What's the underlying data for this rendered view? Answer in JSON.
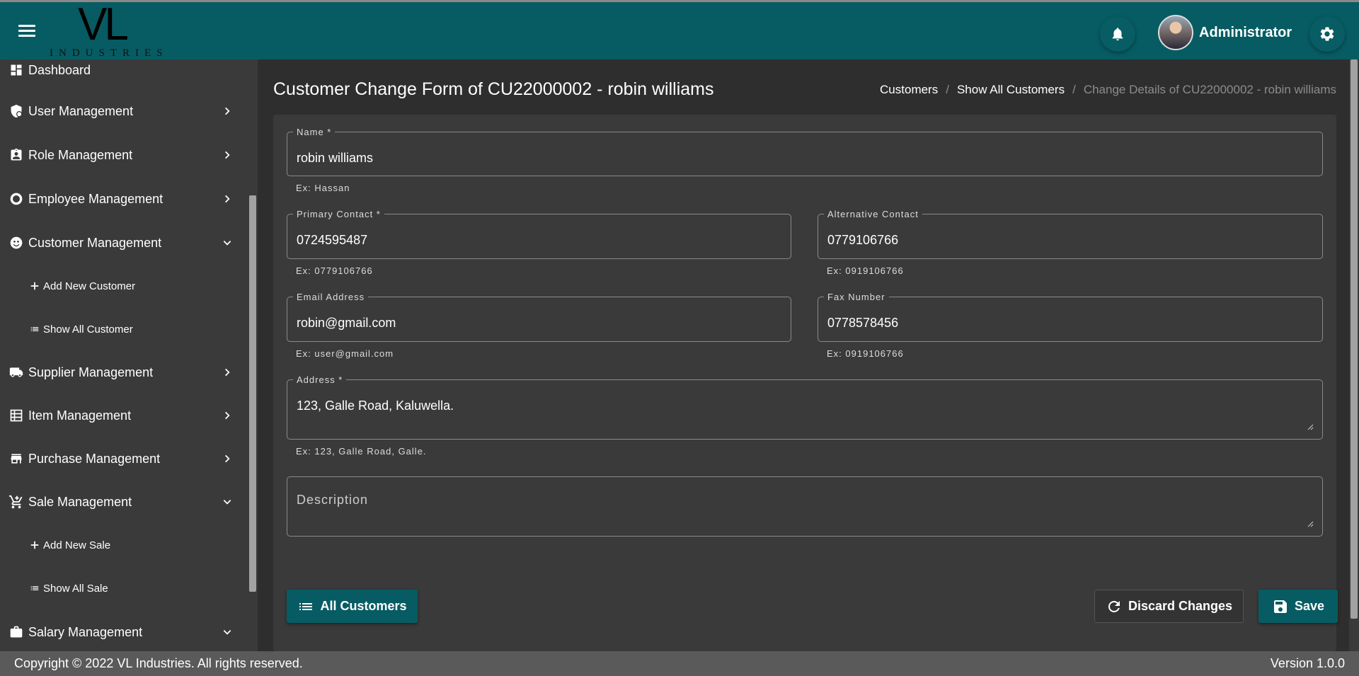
{
  "header": {
    "logo_main": "VL",
    "logo_sub": "INDUSTRIES",
    "user_name": "Administrator",
    "menu_icon": "hamburger-icon",
    "bell_icon": "bell-icon",
    "settings_icon": "gear-icon"
  },
  "sidebar": {
    "items": [
      {
        "label": "Dashboard",
        "icon": "dashboard-icon"
      },
      {
        "label": "User Management",
        "icon": "user-shield-icon"
      },
      {
        "label": "Role Management",
        "icon": "id-badge-icon"
      },
      {
        "label": "Employee Management",
        "icon": "circle-icon"
      },
      {
        "label": "Customer Management",
        "icon": "face-icon"
      },
      {
        "label": "Add New Customer",
        "icon": "plus-icon"
      },
      {
        "label": "Show All Customer",
        "icon": "list-icon"
      },
      {
        "label": "Supplier Management",
        "icon": "truck-icon"
      },
      {
        "label": "Item Management",
        "icon": "table-icon"
      },
      {
        "label": "Purchase Management",
        "icon": "store-icon"
      },
      {
        "label": "Sale Management",
        "icon": "cart-icon"
      },
      {
        "label": "Add New Sale",
        "icon": "plus-icon"
      },
      {
        "label": "Show All Sale",
        "icon": "list-icon"
      },
      {
        "label": "Salary Management",
        "icon": "briefcase-icon"
      }
    ]
  },
  "page": {
    "title": "Customer Change Form of CU22000002 - robin williams",
    "breadcrumb": [
      "Customers",
      "Show All Customers",
      "Change Details of CU22000002 - robin williams"
    ]
  },
  "form": {
    "name": {
      "label": "Name *",
      "value": "robin williams",
      "hint": "Ex: Hassan"
    },
    "primary_contact": {
      "label": "Primary Contact *",
      "value": "0724595487",
      "hint": "Ex: 0779106766"
    },
    "alternative_contact": {
      "label": "Alternative Contact",
      "value": "0779106766",
      "hint": "Ex: 0919106766"
    },
    "email": {
      "label": "Email Address",
      "value": "robin@gmail.com",
      "hint": "Ex: user@gmail.com"
    },
    "fax": {
      "label": "Fax Number",
      "value": "0778578456",
      "hint": "Ex: 0919106766"
    },
    "address": {
      "label": "Address *",
      "value": "123, Galle Road, Kaluwella.",
      "hint": "Ex: 123, Galle Road, Galle."
    },
    "description": {
      "placeholder": "Description",
      "value": ""
    }
  },
  "actions": {
    "all_customers": "All Customers",
    "discard": "Discard Changes",
    "save": "Save"
  },
  "footer": {
    "copyright": "Copyright © 2022 VL Industries. All rights reserved.",
    "version": "Version 1.0.0"
  },
  "colors": {
    "primary": "#075c63",
    "background": "#2e2e2e",
    "panel": "#3a3a3a",
    "footer": "#5a5a5a"
  }
}
